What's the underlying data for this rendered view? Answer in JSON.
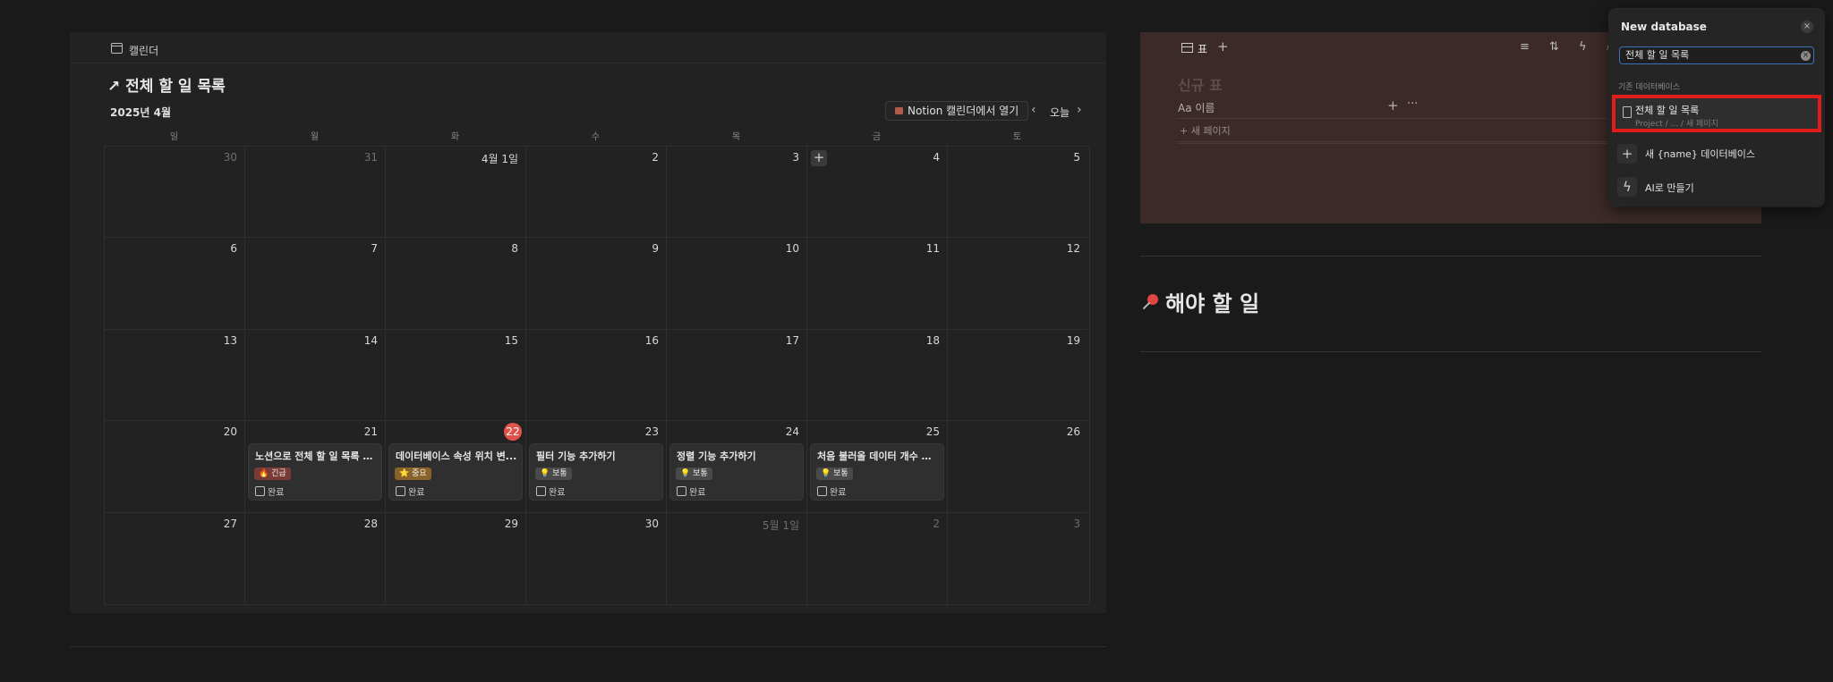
{
  "calendar": {
    "tab_label": "캘린더",
    "title": "↗ 전체 할 일 목록",
    "month": "2025년 4월",
    "open_in_notion": "Notion 캘린더에서 열기",
    "today": "오늘",
    "prev_icon": "chevron-left-icon",
    "next_icon": "chevron-right-icon",
    "weekdays": [
      "일",
      "월",
      "화",
      "수",
      "목",
      "금",
      "토"
    ],
    "weeks": [
      [
        "30",
        "31",
        "4월 1일",
        "2",
        "3",
        "4",
        "5"
      ],
      [
        "6",
        "7",
        "8",
        "9",
        "10",
        "11",
        "12"
      ],
      [
        "13",
        "14",
        "15",
        "16",
        "17",
        "18",
        "19"
      ],
      [
        "20",
        "21",
        "22",
        "23",
        "24",
        "25",
        "26"
      ],
      [
        "27",
        "28",
        "29",
        "30",
        "5월 1일",
        "2",
        "3"
      ]
    ],
    "today_badge": "22",
    "cards": [
      {
        "title": "노션으로 전체 할 일 목록 만...",
        "tag": "🔥 긴급",
        "tag_color": "#7a3b36",
        "check_label": "완료"
      },
      {
        "title": "데이터베이스 속성 위치 변...",
        "tag": "⭐ 중요",
        "tag_color": "#89632a",
        "check_label": "완료"
      },
      {
        "title": "필터 기능 추가하기",
        "tag": "💡 보통",
        "tag_color": "#4a4a4a",
        "check_label": "완료"
      },
      {
        "title": "정렬 기능 추가하기",
        "tag": "💡 보통",
        "tag_color": "#4a4a4a",
        "check_label": "완료"
      },
      {
        "title": "처음 불러올 데이터 개수 지...",
        "tag": "💡 보통",
        "tag_color": "#4a4a4a",
        "check_label": "완료"
      }
    ]
  },
  "database": {
    "view_label": "표",
    "add_view": "+",
    "tools": "≡ ⇅ ϟ ⌕",
    "title": "신규 표",
    "column_name": "Aa 이름",
    "column_add": "+",
    "column_more": "···",
    "new_page": "+ 새 페이지"
  },
  "todo_heading": "해야 할 일",
  "popup": {
    "title": "New database",
    "close": "×",
    "search_value": "전체 할 일 목록",
    "clear": "×",
    "section_label": "기존 데이터베이스",
    "result_title": "전체 할 일 목록",
    "result_path": "Project / ... / 새 페이지",
    "new_db_label": "새 {name} 데이터베이스",
    "new_db_icon": "+",
    "ai_label": "AI로 만들기",
    "ai_icon": "ϟ",
    "highlight_color": "#e21b1b"
  }
}
